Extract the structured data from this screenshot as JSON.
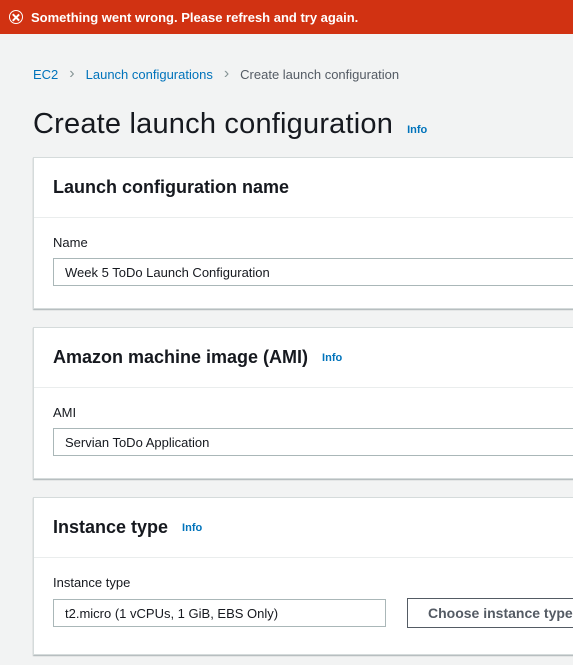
{
  "error_banner": {
    "icon": "error-circle-x-icon",
    "message": "Something went wrong. Please refresh and try again.",
    "color": "#d13212"
  },
  "breadcrumb": {
    "items": [
      "EC2",
      "Launch configurations"
    ],
    "current": "Create launch configuration"
  },
  "page": {
    "title": "Create launch configuration",
    "info": "Info"
  },
  "sections": {
    "name": {
      "title": "Launch configuration name",
      "label": "Name",
      "value": "Week 5 ToDo Launch Configuration"
    },
    "ami": {
      "title": "Amazon machine image (AMI)",
      "info": "Info",
      "label": "AMI",
      "value": "Servian ToDo Application"
    },
    "instance": {
      "title": "Instance type",
      "info": "Info",
      "label": "Instance type",
      "value": "t2.micro (1 vCPUs, 1 GiB, EBS Only)",
      "button": "Choose instance type"
    }
  },
  "colors": {
    "link": "#0073bb",
    "background": "#f2f3f3"
  }
}
